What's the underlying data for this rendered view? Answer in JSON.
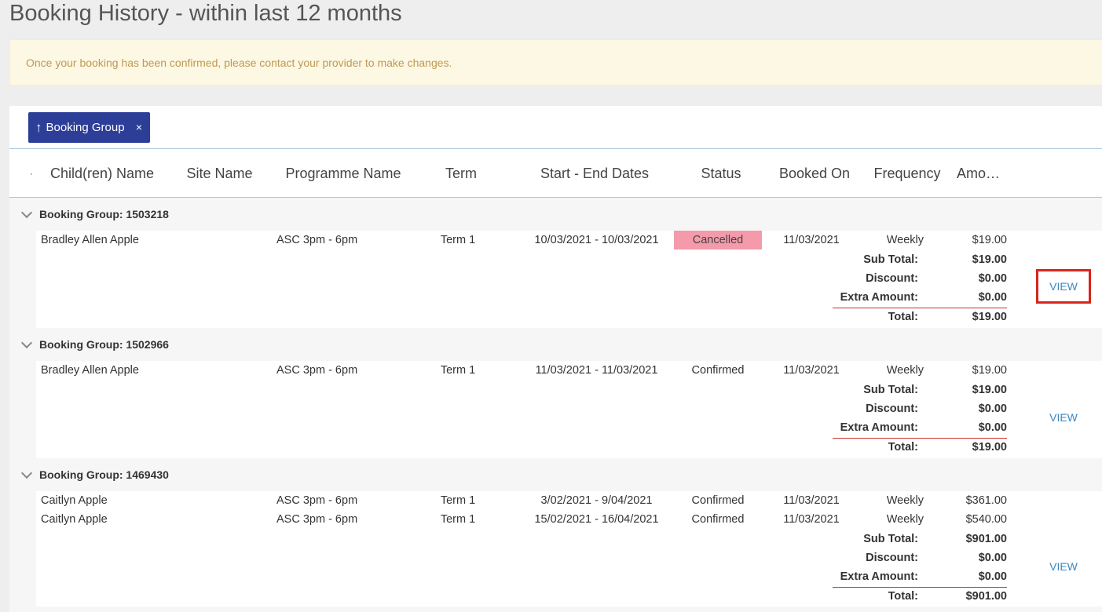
{
  "page": {
    "title": "Booking History - within last 12 months",
    "notice": "Once your booking has been confirmed, please contact your provider to make changes."
  },
  "group_by": {
    "arrow": "↑",
    "label": "Booking Group",
    "remove": "×"
  },
  "columns": {
    "dot": "·",
    "child": "Child(ren) Name",
    "site": "Site Name",
    "programme": "Programme Name",
    "term": "Term",
    "dates": "Start - End Dates",
    "status": "Status",
    "booked_on": "Booked On",
    "frequency": "Frequency",
    "amount": "Amo…"
  },
  "summary_labels": {
    "sub_total": "Sub Total:",
    "discount": "Discount:",
    "extra": "Extra Amount:",
    "total": "Total:"
  },
  "view_label": "VIEW",
  "groups": [
    {
      "header": "Booking Group: 1503218",
      "rows": [
        {
          "child": "Bradley Allen Apple",
          "site": "",
          "programme": "ASC 3pm - 6pm",
          "term": "Term 1",
          "dates": "10/03/2021 - 10/03/2021",
          "status": "Cancelled",
          "booked_on": "11/03/2021",
          "frequency": "Weekly",
          "amount": "$19.00"
        }
      ],
      "sub_total": "$19.00",
      "discount": "$0.00",
      "extra": "$0.00",
      "total": "$19.00"
    },
    {
      "header": "Booking Group: 1502966",
      "rows": [
        {
          "child": "Bradley Allen Apple",
          "site": "",
          "programme": "ASC 3pm - 6pm",
          "term": "Term 1",
          "dates": "11/03/2021 - 11/03/2021",
          "status": "Confirmed",
          "booked_on": "11/03/2021",
          "frequency": "Weekly",
          "amount": "$19.00"
        }
      ],
      "sub_total": "$19.00",
      "discount": "$0.00",
      "extra": "$0.00",
      "total": "$19.00"
    },
    {
      "header": "Booking Group: 1469430",
      "rows": [
        {
          "child": "Caitlyn Apple",
          "site": "",
          "programme": "ASC 3pm - 6pm",
          "term": "Term 1",
          "dates": "3/02/2021 - 9/04/2021",
          "status": "Confirmed",
          "booked_on": "11/03/2021",
          "frequency": "Weekly",
          "amount": "$361.00"
        },
        {
          "child": "Caitlyn Apple",
          "site": "",
          "programme": "ASC 3pm - 6pm",
          "term": "Term 1",
          "dates": "15/02/2021 - 16/04/2021",
          "status": "Confirmed",
          "booked_on": "11/03/2021",
          "frequency": "Weekly",
          "amount": "$540.00"
        }
      ],
      "sub_total": "$901.00",
      "discount": "$0.00",
      "extra": "$0.00",
      "total": "$901.00"
    }
  ],
  "colors": {
    "chip_bg": "#2c3e97",
    "cancelled_bg": "#f49aab",
    "notice_bg": "#fcf8e3",
    "notice_text": "#c09853",
    "link": "#3a87c0",
    "highlight_border": "#d9251c"
  },
  "icons": {
    "group_expand": "chevron-down-icon",
    "sort": "arrow-up-icon",
    "remove": "close-icon"
  }
}
